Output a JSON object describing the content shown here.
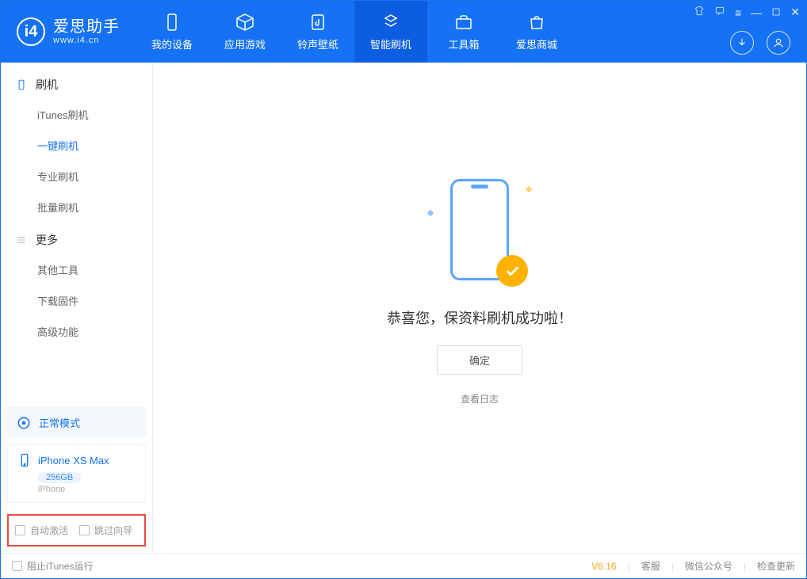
{
  "brand": {
    "title": "爱思助手",
    "subtitle": "www.i4.cn"
  },
  "nav": {
    "device": "我的设备",
    "apps": "应用游戏",
    "ringtone": "铃声壁纸",
    "flash": "智能刷机",
    "toolbox": "工具箱",
    "store": "爱思商城"
  },
  "sidebar": {
    "group_flash": "刷机",
    "itunes_flash": "iTunes刷机",
    "oneclick_flash": "一键刷机",
    "pro_flash": "专业刷机",
    "batch_flash": "批量刷机",
    "group_more": "更多",
    "other_tools": "其他工具",
    "download_fw": "下载固件",
    "advanced": "高级功能"
  },
  "mode": {
    "label": "正常模式"
  },
  "device": {
    "name": "iPhone XS Max",
    "capacity": "256GB",
    "type": "iPhone"
  },
  "options": {
    "auto_activate": "自动激活",
    "skip_guide": "跳过向导"
  },
  "main": {
    "success_text": "恭喜您，保资料刷机成功啦！",
    "ok_button": "确定",
    "view_log": "查看日志"
  },
  "footer": {
    "block_itunes": "阻止iTunes运行",
    "version": "V8.16",
    "support": "客服",
    "wechat": "微信公众号",
    "check_update": "检查更新"
  }
}
